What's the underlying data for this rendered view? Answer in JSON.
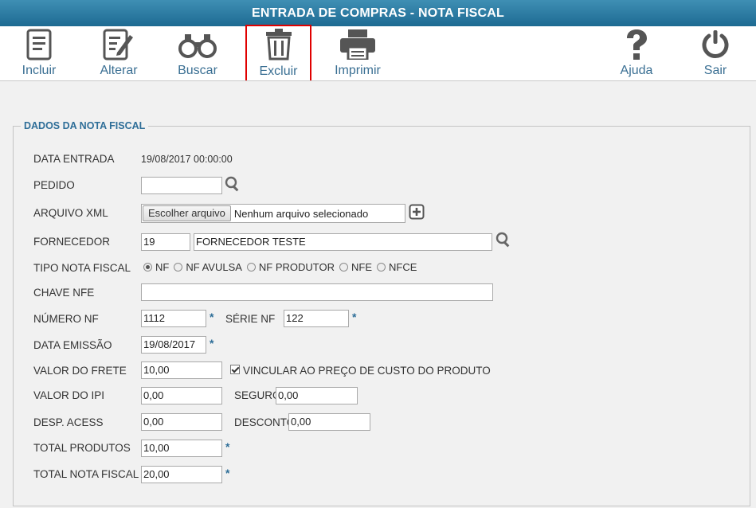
{
  "window": {
    "title": "ENTRADA DE COMPRAS - NOTA FISCAL"
  },
  "toolbar": {
    "incluir": "Incluir",
    "alterar": "Alterar",
    "buscar": "Buscar",
    "excluir": "Excluir",
    "imprimir": "Imprimir",
    "ajuda": "Ajuda",
    "sair": "Sair",
    "selected": "Excluir",
    "selected_color": "#e00000"
  },
  "form": {
    "legend": "DADOS DA NOTA FISCAL",
    "data_entrada": {
      "label": "DATA ENTRADA",
      "value": "19/08/2017 00:00:00"
    },
    "pedido": {
      "label": "PEDIDO",
      "value": ""
    },
    "arquivo_xml": {
      "label": "ARQUIVO XML",
      "button": "Escolher arquivo",
      "status": "Nenhum arquivo selecionado"
    },
    "fornecedor": {
      "label": "FORNECEDOR",
      "code": "19",
      "name": "FORNECEDOR TESTE"
    },
    "tipo_nota": {
      "label": "TIPO NOTA FISCAL",
      "options": [
        "NF",
        "NF AVULSA",
        "NF PRODUTOR",
        "NFE",
        "NFCE"
      ],
      "selected": "NF"
    },
    "chave_nfe": {
      "label": "CHAVE NFE",
      "value": ""
    },
    "numero_nf": {
      "label": "NÚMERO NF",
      "value": "1112"
    },
    "serie_nf": {
      "label": "SÉRIE NF",
      "value": "122"
    },
    "data_emissao": {
      "label": "DATA EMISSÃO",
      "value": "19/08/2017"
    },
    "valor_frete": {
      "label": "VALOR DO FRETE",
      "value": "10,00"
    },
    "vincular": {
      "label": "VINCULAR AO PREÇO DE CUSTO DO PRODUTO",
      "checked": true
    },
    "valor_ipi": {
      "label": "VALOR DO IPI",
      "value": "0,00"
    },
    "seguro": {
      "label": "SEGURO",
      "value": "0,00"
    },
    "desp_acess": {
      "label": "DESP. ACESS",
      "value": "0,00"
    },
    "desconto": {
      "label": "DESCONTO",
      "value": "0,00"
    },
    "total_produtos": {
      "label": "TOTAL PRODUTOS",
      "value": "10,00"
    },
    "total_nota": {
      "label": "TOTAL NOTA FISCAL",
      "value": "20,00"
    },
    "required_mark": "*"
  },
  "colors": {
    "title_bar": "#2a7aa3",
    "accent": "#2e6e98",
    "icon": "#555555"
  },
  "icons": {
    "incluir": "document-icon",
    "alterar": "edit-document-icon",
    "buscar": "binoculars-icon",
    "excluir": "trash-icon",
    "imprimir": "printer-icon",
    "ajuda": "question-icon",
    "sair": "power-icon",
    "lupa": "magnifier-icon",
    "add": "plus-square-icon"
  }
}
